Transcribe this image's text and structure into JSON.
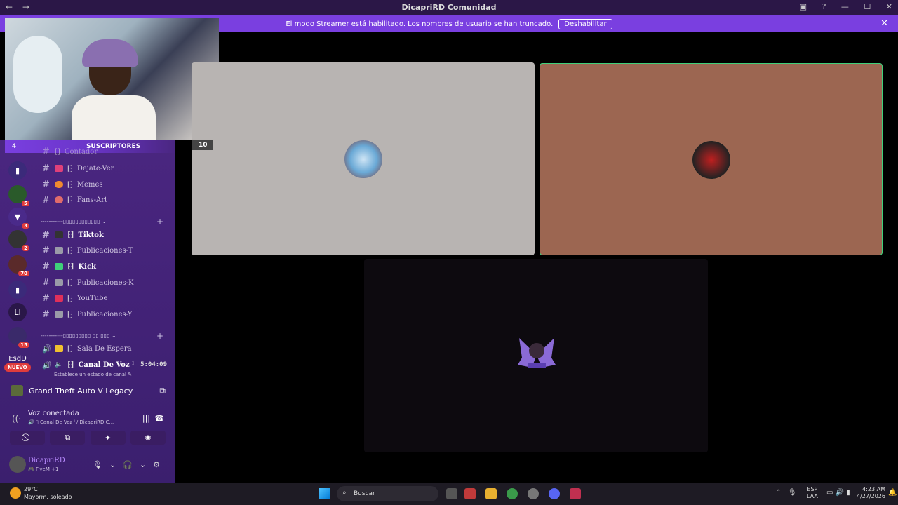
{
  "window": {
    "title": "DicapriRD Comunidad",
    "back": "←",
    "forward": "→"
  },
  "banner": {
    "text": "El modo Streamer está habilitado. Los nombres de usuario se han truncado.",
    "button": "Deshabilitar",
    "close": "✕"
  },
  "sub_bar": {
    "count": "4",
    "label": "SUSCRIPTORES"
  },
  "servers": [
    {
      "badge": ""
    },
    {
      "badge": "5"
    },
    {
      "badge": "3"
    },
    {
      "badge": "2"
    },
    {
      "badge": "70"
    },
    {
      "badge": ""
    },
    {
      "label": "LI",
      "badge": ""
    },
    {
      "badge": "15"
    },
    {
      "label": "EsdD",
      "badge": ""
    }
  ],
  "nuevo": "NUEVO",
  "channels": {
    "partial": "Contador",
    "group1": [
      {
        "name": "Dejate-Ver",
        "color": "#e0407a"
      },
      {
        "name": "Memes",
        "color": "#f08a30"
      },
      {
        "name": "Fans-Art",
        "color": "#e06b6b"
      }
    ],
    "category1": "-----------▯▯▯▯▯▯▯▯▯▯▯▯ ⌄",
    "group2": [
      {
        "name": "Tiktok",
        "color": "#333333",
        "bold": true
      },
      {
        "name": "Publicaciones-T",
        "color": "#9a9aa8",
        "bold": false
      },
      {
        "name": "Kick",
        "color": "#3fd07a",
        "bold": true
      },
      {
        "name": "Publicaciones-K",
        "color": "#9a9aa8",
        "bold": false
      },
      {
        "name": "YouTube",
        "color": "#e0305a",
        "bold": false
      },
      {
        "name": "Publicaciones-Y",
        "color": "#9a9aa8",
        "bold": false
      }
    ],
    "category2": "-----------▯▯▯▯▯▯▯▯▯ ▯▯ ▯▯▯ ⌄",
    "voice": [
      {
        "name": "Sala De Espera",
        "bold": false
      },
      {
        "name": "Canal De Voz ˡ",
        "bold": true,
        "time": "5:04:09"
      }
    ],
    "estado": "Establece un estado de canal ✎",
    "plus": "+"
  },
  "activity": {
    "game": "Grand Theft Auto V Legacy",
    "icon": "screen-share-icon"
  },
  "voice": {
    "status": "Voz conectada",
    "detail": "🔊 ▯ Canal De Voz ˡ / DicapriRD C..."
  },
  "user": {
    "name": "DicapriRD",
    "status": "🎮 FiveM +1"
  },
  "tiles": [
    {
      "badge": "10"
    },
    {},
    {}
  ],
  "taskbar": {
    "temp": "29°C",
    "cond": "Mayorm. soleado",
    "search": "Buscar",
    "lang1": "ESP",
    "lang2": "LAA",
    "time": "4:23 AM",
    "date": "4/27/2026"
  }
}
